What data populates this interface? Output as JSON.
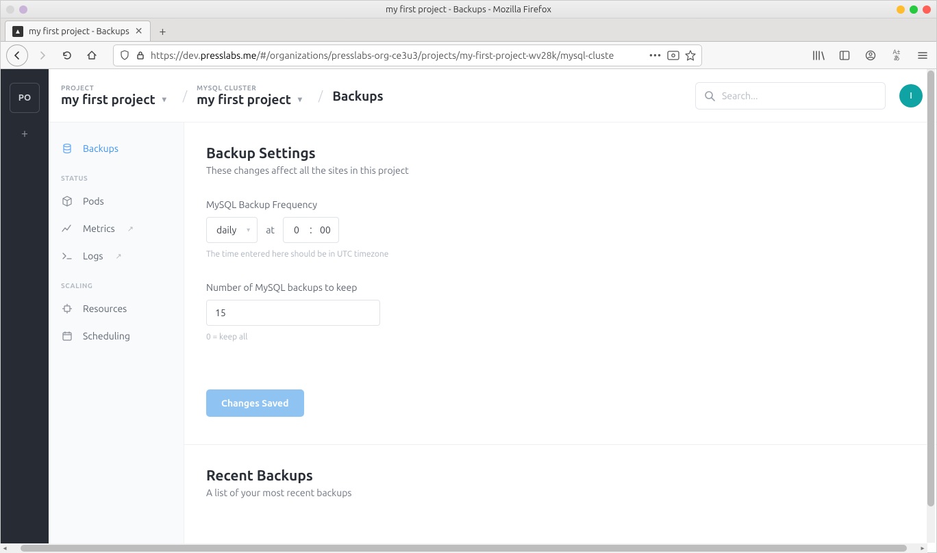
{
  "window": {
    "title": "my first project - Backups - Mozilla Firefox"
  },
  "tab": {
    "title": "my first project - Backups"
  },
  "url": {
    "prefix": "https://dev.",
    "host": "presslabs.me",
    "path": "/#/organizations/presslabs-org-ce3u3/projects/my-first-project-wv28k/mysql-cluste"
  },
  "rail": {
    "org": "PO"
  },
  "breadcrumb": {
    "project_label": "PROJECT",
    "project_value": "my first project",
    "cluster_label": "MYSQL CLUSTER",
    "cluster_value": "my first project",
    "page": "Backups"
  },
  "search": {
    "placeholder": "Search..."
  },
  "avatar": {
    "initial": "I"
  },
  "sidemenu": {
    "backups": "Backups",
    "status_head": "STATUS",
    "pods": "Pods",
    "metrics": "Metrics",
    "logs": "Logs",
    "scaling_head": "SCALING",
    "resources": "Resources",
    "scheduling": "Scheduling"
  },
  "settings": {
    "title": "Backup Settings",
    "subtitle": "These changes affect all the sites in this project",
    "freq_label": "MySQL Backup Frequency",
    "freq_value": "daily",
    "at": "at",
    "hour": "0",
    "minute": "00",
    "tz_hint": "The time entered here should be in UTC timezone",
    "keep_label": "Number of MySQL backups to keep",
    "keep_value": "15",
    "keep_hint": "0 = keep all",
    "save_button": "Changes Saved"
  },
  "recent": {
    "title": "Recent Backups",
    "subtitle": "A list of your most recent backups"
  }
}
